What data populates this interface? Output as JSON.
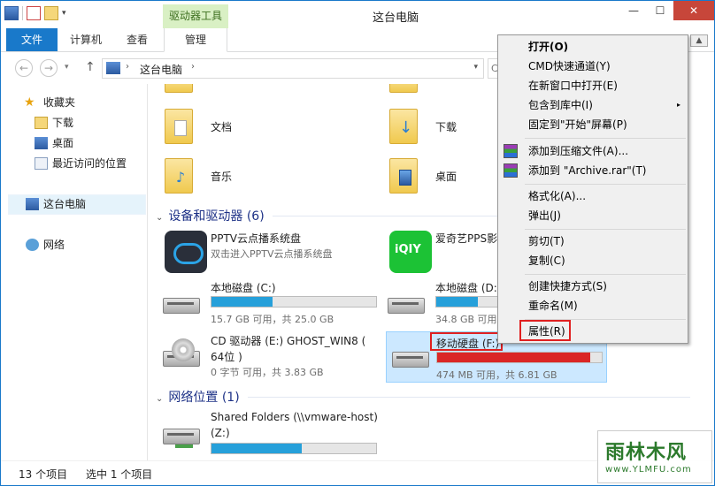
{
  "window": {
    "title": "这台电脑",
    "contextual_tab_group": "驱动器工具",
    "controls": {
      "minimize": "—",
      "maximize": "☐",
      "close": "✕"
    }
  },
  "ribbon": {
    "tabs": [
      {
        "label": "文件",
        "active": true
      },
      {
        "label": "计算机"
      },
      {
        "label": "查看"
      },
      {
        "label": "管理"
      }
    ]
  },
  "nav": {
    "back": "←",
    "forward": "→",
    "dropdown": "▾",
    "up": "↑",
    "address": {
      "separator": "›",
      "location": "这台电脑",
      "dropdown": "▾"
    },
    "search_stub": "C"
  },
  "sidebar": {
    "items": [
      {
        "label": "收藏夹",
        "icon": "star-icon",
        "level": 0
      },
      {
        "label": "下载",
        "icon": "downloads-folder-icon",
        "level": 1
      },
      {
        "label": "桌面",
        "icon": "desktop-icon",
        "level": 1
      },
      {
        "label": "最近访问的位置",
        "icon": "recent-places-icon",
        "level": 1
      },
      {
        "label": "这台电脑",
        "icon": "computer-icon",
        "level": 0,
        "selected": true
      },
      {
        "label": "网络",
        "icon": "network-icon",
        "level": 0
      }
    ]
  },
  "folders": [
    {
      "label": "文档",
      "icon": "documents-folder-icon"
    },
    {
      "label": "下载",
      "icon": "downloads-folder-icon"
    },
    {
      "label": "音乐",
      "icon": "music-folder-icon"
    },
    {
      "label": "桌面",
      "icon": "desktop-folder-icon"
    }
  ],
  "groups": {
    "devices": {
      "chevron": "⌄",
      "label": "设备和驱动器 (6)"
    },
    "network": {
      "chevron": "⌄",
      "label": "网络位置 (1)"
    }
  },
  "drives": [
    {
      "name": "PPTV云点播系统盘",
      "sub": "双击进入PPTV云点播系统盘",
      "icon": "pptv-icon"
    },
    {
      "name": "爱奇艺PPS影",
      "icon": "iqiyi-icon"
    },
    {
      "name": "本地磁盘 (C:)",
      "free": "15.7 GB 可用，共 25.0 GB",
      "used_fraction": 0.37,
      "icon": "hard-drive-icon"
    },
    {
      "name": "本地磁盘 (D:",
      "free": "34.8 GB 可用，",
      "used_fraction": 0.25,
      "icon": "hard-drive-icon"
    },
    {
      "name": "CD 驱动器 (E:) GHOST_WIN8 (",
      "name2": "64位 )",
      "free": "0 字节 可用，共 3.83 GB",
      "icon": "cd-drive-icon"
    },
    {
      "name": "移动硬盘 (F:)",
      "free": "474 MB 可用，共 6.81 GB",
      "used_fraction": 0.93,
      "selected": true,
      "icon": "removable-drive-icon"
    }
  ],
  "network_locations": [
    {
      "name": "Shared Folders (\\\\vmware-host)",
      "name2": "(Z:)",
      "used_fraction": 0.55,
      "icon": "network-drive-icon"
    }
  ],
  "context_menu": {
    "items": [
      {
        "label": "打开(O)",
        "bold": true
      },
      {
        "label": "CMD快速通道(Y)"
      },
      {
        "label": "在新窗口中打开(E)"
      },
      {
        "label": "包含到库中(I)",
        "submenu": "▸"
      },
      {
        "label": "固定到\"开始\"屏幕(P)"
      },
      {
        "label": "添加到压缩文件(A)...",
        "icon": "winrar-icon"
      },
      {
        "label": "添加到 \"Archive.rar\"(T)",
        "icon": "winrar-icon"
      },
      {
        "label": "格式化(A)..."
      },
      {
        "label": "弹出(J)"
      },
      {
        "label": "剪切(T)"
      },
      {
        "label": "复制(C)"
      },
      {
        "label": "创建快捷方式(S)"
      },
      {
        "label": "重命名(M)"
      },
      {
        "label": "属性(R)",
        "highlighted": true
      }
    ]
  },
  "scroll_up": "▲",
  "status": {
    "item_count": "13 个项目",
    "selected_count": "选中 1 个项目"
  },
  "watermark": {
    "logo": "雨林木风",
    "sub": "www.YLMFU.com"
  },
  "colors": {
    "accent": "#1979ca",
    "selection": "#cce8ff",
    "bar_blue": "#26a0da",
    "bar_red": "#da2626",
    "highlight": "#e02020"
  }
}
